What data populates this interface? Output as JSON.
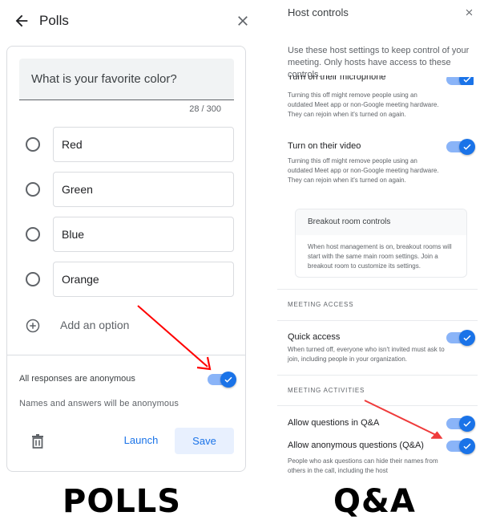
{
  "polls": {
    "title": "Polls",
    "question": "What is your favorite color?",
    "char_count": "28 / 300",
    "options": [
      "Red",
      "Green",
      "Blue",
      "Orange"
    ],
    "add_option_label": "Add an option",
    "anonymous_label": "All responses are anonymous",
    "anonymous_enabled": true,
    "anonymous_description": "Names and answers will be anonymous",
    "launch_label": "Launch",
    "save_label": "Save"
  },
  "host_controls": {
    "title": "Host controls",
    "intro": "Use these host settings to keep control of your meeting. Only hosts have access to these controls.",
    "microphone": {
      "title": "Turn on their microphone",
      "enabled": true,
      "description": "Turning this off might remove people using an outdated Meet app or non-Google meeting hardware. They can rejoin when it's turned on again."
    },
    "video": {
      "title": "Turn on their video",
      "enabled": true,
      "description": "Turning this off might remove people using an outdated Meet app or non-Google meeting hardware. They can rejoin when it's turned on again."
    },
    "breakout": {
      "title": "Breakout room controls",
      "description": "When host management is on, breakout rooms will start with the same main room settings. Join a breakout room to customize its settings."
    },
    "meeting_access_label": "MEETING ACCESS",
    "quick_access": {
      "title": "Quick access",
      "enabled": true,
      "description": "When turned off, everyone who isn't invited must ask to join, including people in your organization."
    },
    "meeting_activities_label": "MEETING ACTIVITIES",
    "qa_questions": {
      "title": "Allow questions in Q&A",
      "enabled": true
    },
    "qa_anonymous": {
      "title": "Allow anonymous questions (Q&A)",
      "enabled": true,
      "description": "People who ask questions can hide their names from others in the call, including the host"
    }
  },
  "captions": {
    "left": "POLLS",
    "right": "Q&A"
  },
  "colors": {
    "accent": "#1a73e8",
    "toggle_track": "#8ab4f8",
    "save_bg": "#e8f0fe",
    "annotation_arrow": "#ff0000"
  }
}
